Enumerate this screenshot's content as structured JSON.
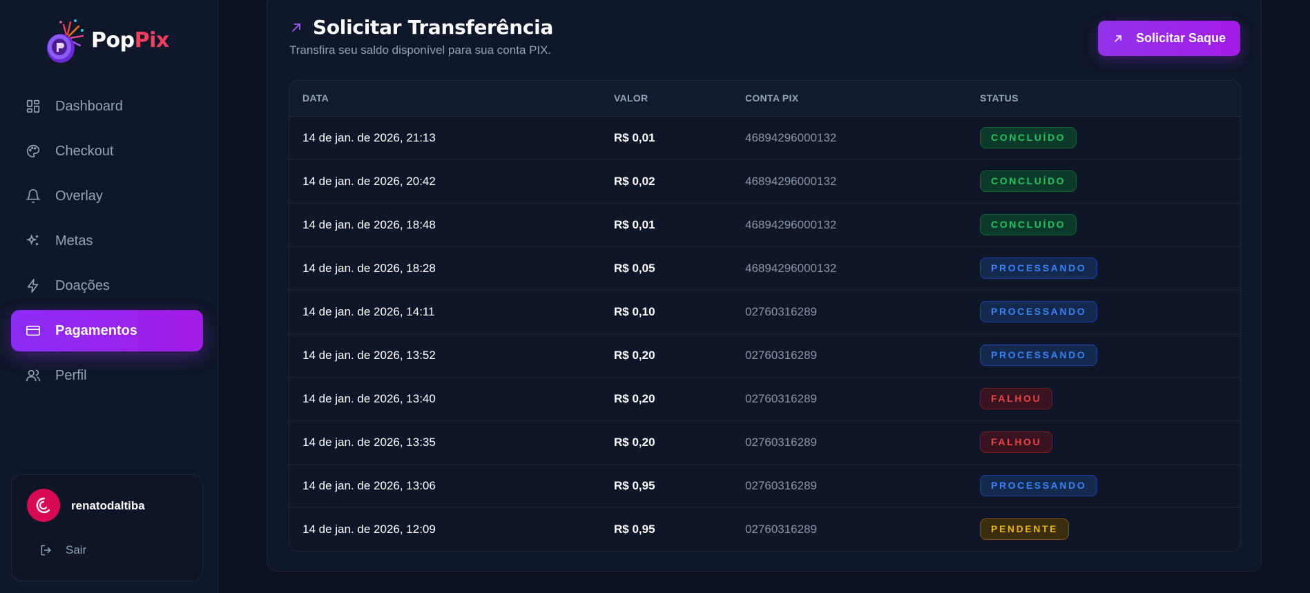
{
  "brand": {
    "name_part1": "Pop",
    "name_part2": "Pix"
  },
  "sidebar": {
    "items": [
      {
        "label": "Dashboard",
        "icon": "dashboard-icon",
        "active": false
      },
      {
        "label": "Checkout",
        "icon": "palette-icon",
        "active": false
      },
      {
        "label": "Overlay",
        "icon": "bell-icon",
        "active": false
      },
      {
        "label": "Metas",
        "icon": "sparkles-icon",
        "active": false
      },
      {
        "label": "Doações",
        "icon": "zap-icon",
        "active": false
      },
      {
        "label": "Pagamentos",
        "icon": "credit-card-icon",
        "active": true
      },
      {
        "label": "Perfil",
        "icon": "users-icon",
        "active": false
      }
    ]
  },
  "user": {
    "username": "renatodaltiba",
    "logout_label": "Sair"
  },
  "panel": {
    "title": "Solicitar Transferência",
    "subtitle": "Transfira seu saldo disponível para sua conta PIX.",
    "button_label": "Solicitar Saque"
  },
  "table": {
    "headers": [
      "DATA",
      "VALOR",
      "CONTA PIX",
      "STATUS"
    ],
    "rows": [
      {
        "date": "14 de jan. de 2026, 21:13",
        "valor": "R$ 0,01",
        "pix": "46894296000132",
        "status": "CONCLUÍDO",
        "kind": "ok"
      },
      {
        "date": "14 de jan. de 2026, 20:42",
        "valor": "R$ 0,02",
        "pix": "46894296000132",
        "status": "CONCLUÍDO",
        "kind": "ok"
      },
      {
        "date": "14 de jan. de 2026, 18:48",
        "valor": "R$ 0,01",
        "pix": "46894296000132",
        "status": "CONCLUÍDO",
        "kind": "ok"
      },
      {
        "date": "14 de jan. de 2026, 18:28",
        "valor": "R$ 0,05",
        "pix": "46894296000132",
        "status": "PROCESSANDO",
        "kind": "proc"
      },
      {
        "date": "14 de jan. de 2026, 14:11",
        "valor": "R$ 0,10",
        "pix": "02760316289",
        "status": "PROCESSANDO",
        "kind": "proc"
      },
      {
        "date": "14 de jan. de 2026, 13:52",
        "valor": "R$ 0,20",
        "pix": "02760316289",
        "status": "PROCESSANDO",
        "kind": "proc"
      },
      {
        "date": "14 de jan. de 2026, 13:40",
        "valor": "R$ 0,20",
        "pix": "02760316289",
        "status": "FALHOU",
        "kind": "fail"
      },
      {
        "date": "14 de jan. de 2026, 13:35",
        "valor": "R$ 0,20",
        "pix": "02760316289",
        "status": "FALHOU",
        "kind": "fail"
      },
      {
        "date": "14 de jan. de 2026, 13:06",
        "valor": "R$ 0,95",
        "pix": "02760316289",
        "status": "PROCESSANDO",
        "kind": "proc"
      },
      {
        "date": "14 de jan. de 2026, 12:09",
        "valor": "R$ 0,95",
        "pix": "02760316289",
        "status": "PENDENTE",
        "kind": "pend"
      }
    ]
  },
  "colors": {
    "accent": "#9333ea",
    "brand_red": "#f43f5e",
    "success": "#22c55e",
    "processing": "#3b82f6",
    "failed": "#ef4444",
    "pending": "#eab308"
  }
}
